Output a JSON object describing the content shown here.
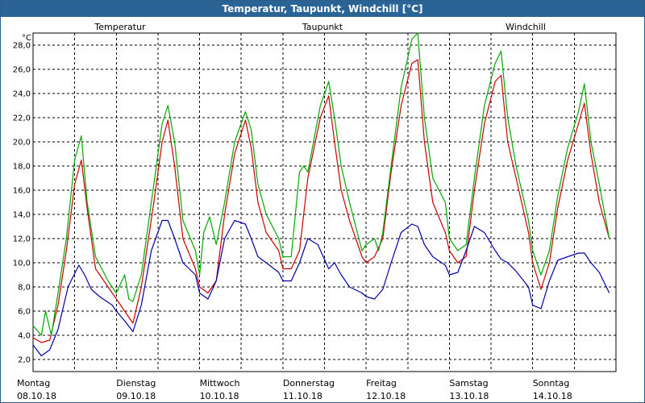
{
  "window": {
    "title": "Temperatur, Taupunkt, Windchill [°C]"
  },
  "chart_data": {
    "type": "line",
    "title": "Temperatur, Taupunkt, Windchill [°C]",
    "ylabel": "°C",
    "ylim": [
      1.0,
      29.0
    ],
    "y_ticks": [
      "2,0",
      "4,0",
      "6,0",
      "8,0",
      "10,0",
      "12,0",
      "14,0",
      "16,0",
      "18,0",
      "20,0",
      "22,0",
      "24,0",
      "26,0",
      "28,0"
    ],
    "x_range_days": [
      0,
      7
    ],
    "x_labels": [
      {
        "day": "Montag",
        "date": "08.10.18"
      },
      {
        "day": "Dienstag",
        "date": "09.10.18"
      },
      {
        "day": "Mittwoch",
        "date": "10.10.18"
      },
      {
        "day": "Donnerstag",
        "date": "11.10.18"
      },
      {
        "day": "Freitag",
        "date": "12.10.18"
      },
      {
        "day": "Samstag",
        "date": "13.10.18"
      },
      {
        "day": "Sonntag",
        "date": "14.10.18"
      }
    ],
    "grid": true,
    "legend_position": "top",
    "series": [
      {
        "name": "Temperatur",
        "color": "#cc0000",
        "x": [
          0.0,
          0.1,
          0.2,
          0.3,
          0.4,
          0.5,
          0.58,
          0.65,
          0.75,
          0.9,
          1.0,
          1.1,
          1.2,
          1.3,
          1.45,
          1.55,
          1.62,
          1.7,
          1.8,
          1.95,
          2.0,
          2.1,
          2.2,
          2.3,
          2.42,
          2.55,
          2.62,
          2.7,
          2.8,
          2.95,
          3.0,
          3.1,
          3.2,
          3.3,
          3.45,
          3.55,
          3.62,
          3.7,
          3.8,
          3.95,
          4.0,
          4.1,
          4.2,
          4.3,
          4.42,
          4.55,
          4.62,
          4.7,
          4.8,
          4.95,
          5.0,
          5.1,
          5.2,
          5.3,
          5.42,
          5.55,
          5.62,
          5.7,
          5.8,
          5.95,
          6.0,
          6.1,
          6.2,
          6.3,
          6.42,
          6.55,
          6.62,
          6.7,
          6.8,
          6.92
        ],
        "values": [
          3.8,
          3.4,
          3.6,
          6.5,
          11.0,
          16.5,
          18.5,
          14.5,
          9.5,
          8.0,
          7.0,
          6.0,
          5.0,
          8.0,
          15.0,
          20.0,
          21.8,
          18.0,
          12.0,
          9.5,
          8.0,
          7.5,
          8.5,
          14.0,
          19.0,
          21.8,
          19.5,
          15.0,
          12.5,
          11.0,
          9.5,
          9.5,
          11.0,
          17.0,
          22.0,
          23.8,
          20.0,
          16.0,
          13.5,
          10.5,
          10.0,
          10.5,
          12.0,
          17.5,
          23.0,
          26.5,
          26.8,
          20.0,
          15.0,
          12.5,
          11.0,
          10.0,
          10.5,
          16.0,
          21.5,
          25.0,
          25.5,
          20.0,
          17.0,
          12.5,
          10.0,
          7.8,
          10.0,
          14.5,
          18.5,
          21.5,
          23.2,
          19.0,
          15.0,
          12.0
        ]
      },
      {
        "name": "Taupunkt",
        "color": "#0000aa",
        "x": [
          0.0,
          0.1,
          0.2,
          0.3,
          0.42,
          0.55,
          0.62,
          0.7,
          0.8,
          0.95,
          1.0,
          1.1,
          1.2,
          1.3,
          1.42,
          1.55,
          1.62,
          1.7,
          1.8,
          1.95,
          2.0,
          2.1,
          2.2,
          2.3,
          2.42,
          2.55,
          2.62,
          2.7,
          2.8,
          2.95,
          3.0,
          3.1,
          3.2,
          3.3,
          3.42,
          3.55,
          3.62,
          3.7,
          3.8,
          3.95,
          4.0,
          4.1,
          4.2,
          4.3,
          4.42,
          4.55,
          4.62,
          4.7,
          4.8,
          4.95,
          5.0,
          5.1,
          5.2,
          5.3,
          5.42,
          5.55,
          5.62,
          5.7,
          5.8,
          5.95,
          6.0,
          6.1,
          6.2,
          6.3,
          6.42,
          6.55,
          6.62,
          6.7,
          6.8,
          6.92
        ],
        "values": [
          3.2,
          2.3,
          2.8,
          4.5,
          8.0,
          9.8,
          9.0,
          7.8,
          7.2,
          6.5,
          6.0,
          5.2,
          4.3,
          6.5,
          11.0,
          13.5,
          13.5,
          12.0,
          10.0,
          9.0,
          7.5,
          7.0,
          8.5,
          12.0,
          13.5,
          13.2,
          12.0,
          10.5,
          10.0,
          9.2,
          8.5,
          8.5,
          10.0,
          12.0,
          11.5,
          9.5,
          10.0,
          9.0,
          8.0,
          7.5,
          7.2,
          7.0,
          7.8,
          10.0,
          12.5,
          13.2,
          13.0,
          11.5,
          10.5,
          9.8,
          9.0,
          9.2,
          11.0,
          13.0,
          12.5,
          11.0,
          10.3,
          10.0,
          9.3,
          8.0,
          6.5,
          6.2,
          8.5,
          10.2,
          10.5,
          10.8,
          10.8,
          10.0,
          9.2,
          7.5
        ]
      },
      {
        "name": "Windchill",
        "color": "#00aa00",
        "x": [
          0.0,
          0.1,
          0.15,
          0.22,
          0.3,
          0.4,
          0.5,
          0.58,
          0.65,
          0.75,
          0.9,
          1.0,
          1.1,
          1.15,
          1.2,
          1.3,
          1.45,
          1.55,
          1.62,
          1.7,
          1.8,
          1.95,
          2.0,
          2.05,
          2.12,
          2.2,
          2.3,
          2.42,
          2.55,
          2.62,
          2.7,
          2.8,
          2.95,
          3.0,
          3.1,
          3.2,
          3.25,
          3.3,
          3.45,
          3.55,
          3.62,
          3.7,
          3.8,
          3.95,
          4.0,
          4.1,
          4.15,
          4.2,
          4.3,
          4.42,
          4.55,
          4.62,
          4.7,
          4.8,
          4.95,
          5.0,
          5.1,
          5.2,
          5.3,
          5.42,
          5.55,
          5.62,
          5.7,
          5.8,
          5.95,
          6.0,
          6.1,
          6.2,
          6.3,
          6.42,
          6.55,
          6.62,
          6.7,
          6.8,
          6.92
        ],
        "values": [
          4.8,
          4.0,
          6.0,
          4.0,
          7.5,
          12.0,
          18.5,
          20.5,
          15.0,
          10.5,
          8.5,
          7.5,
          9.0,
          7.0,
          6.8,
          9.0,
          16.5,
          21.5,
          23.0,
          20.0,
          13.5,
          11.0,
          9.0,
          12.5,
          13.8,
          11.5,
          15.0,
          20.0,
          22.5,
          21.0,
          16.5,
          14.0,
          12.0,
          10.5,
          10.5,
          17.5,
          18.0,
          17.5,
          23.0,
          25.0,
          22.0,
          18.0,
          15.0,
          11.0,
          11.5,
          12.0,
          11.0,
          12.5,
          18.0,
          24.5,
          28.5,
          29.0,
          22.0,
          17.0,
          15.0,
          12.0,
          11.0,
          11.5,
          17.0,
          23.0,
          26.5,
          27.5,
          22.0,
          18.0,
          13.5,
          11.0,
          9.0,
          11.0,
          15.5,
          19.5,
          22.5,
          24.8,
          20.0,
          16.5,
          12.0
        ]
      }
    ]
  }
}
